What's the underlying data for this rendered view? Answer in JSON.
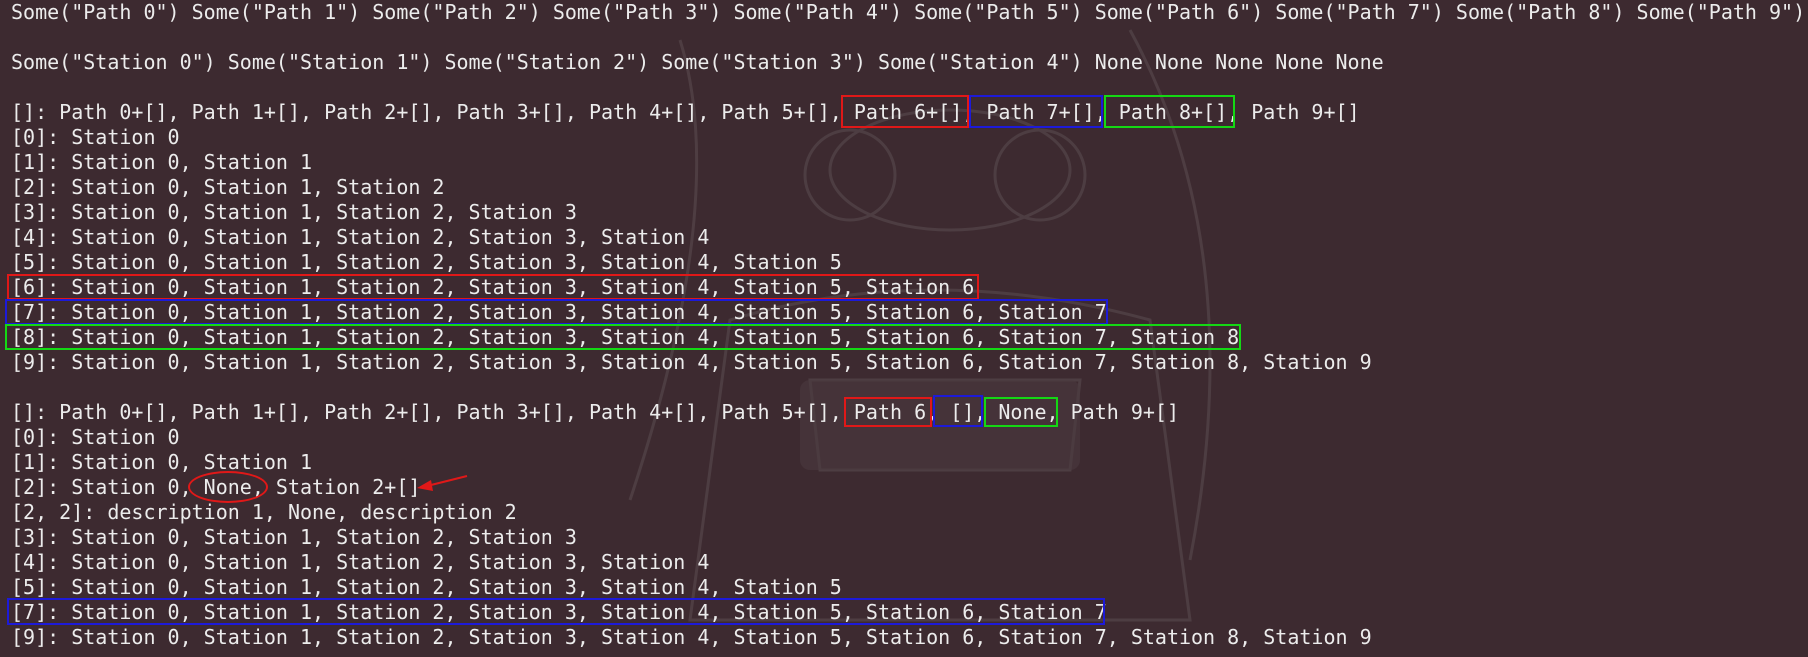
{
  "terminal": {
    "lines": [
      "Some(\"Path 0\") Some(\"Path 1\") Some(\"Path 2\") Some(\"Path 3\") Some(\"Path 4\") Some(\"Path 5\") Some(\"Path 6\") Some(\"Path 7\") Some(\"Path 8\") Some(\"Path 9\")",
      "",
      "Some(\"Station 0\") Some(\"Station 1\") Some(\"Station 2\") Some(\"Station 3\") Some(\"Station 4\") None None None None None",
      "",
      "[]: Path 0+[], Path 1+[], Path 2+[], Path 3+[], Path 4+[], Path 5+[], Path 6+[], Path 7+[], Path 8+[], Path 9+[]",
      "[0]: Station 0",
      "[1]: Station 0, Station 1",
      "[2]: Station 0, Station 1, Station 2",
      "[3]: Station 0, Station 1, Station 2, Station 3",
      "[4]: Station 0, Station 1, Station 2, Station 3, Station 4",
      "[5]: Station 0, Station 1, Station 2, Station 3, Station 4, Station 5",
      "[6]: Station 0, Station 1, Station 2, Station 3, Station 4, Station 5, Station 6",
      "[7]: Station 0, Station 1, Station 2, Station 3, Station 4, Station 5, Station 6, Station 7",
      "[8]: Station 0, Station 1, Station 2, Station 3, Station 4, Station 5, Station 6, Station 7, Station 8",
      "[9]: Station 0, Station 1, Station 2, Station 3, Station 4, Station 5, Station 6, Station 7, Station 8, Station 9",
      "",
      "[]: Path 0+[], Path 1+[], Path 2+[], Path 3+[], Path 4+[], Path 5+[], Path 6, [], None, Path 9+[]",
      "[0]: Station 0",
      "[1]: Station 0, Station 1",
      "[2]: Station 0, None, Station 2+[]",
      "[2, 2]: description 1, None, description 2",
      "[3]: Station 0, Station 1, Station 2, Station 3",
      "[4]: Station 0, Station 1, Station 2, Station 3, Station 4",
      "[5]: Station 0, Station 1, Station 2, Station 3, Station 4, Station 5",
      "[7]: Station 0, Station 1, Station 2, Station 3, Station 4, Station 5, Station 6, Station 7",
      "[9]: Station 0, Station 1, Station 2, Station 3, Station 4, Station 5, Station 6, Station 7, Station 8, Station 9"
    ]
  },
  "annotation_colors": {
    "red": "#e01818",
    "blue": "#1d1ad8",
    "green": "#14d814"
  },
  "background": "#3d2a30"
}
